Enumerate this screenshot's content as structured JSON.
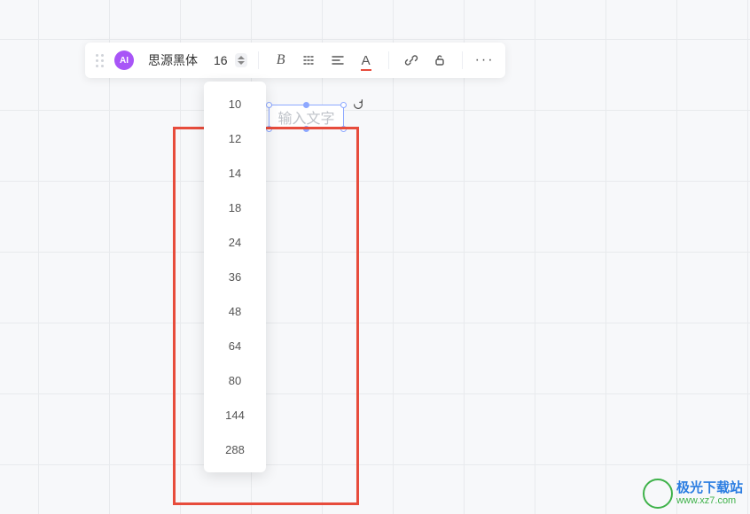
{
  "toolbar": {
    "ai_label": "AI",
    "font_name": "思源黑体",
    "font_size": "16",
    "more": "···"
  },
  "textbox": {
    "placeholder": "输入文字"
  },
  "dropdown": {
    "items": [
      "10",
      "12",
      "14",
      "18",
      "24",
      "36",
      "48",
      "64",
      "80",
      "144",
      "288"
    ]
  },
  "watermark": {
    "title": "极光下载站",
    "url": "www.xz7.com"
  }
}
